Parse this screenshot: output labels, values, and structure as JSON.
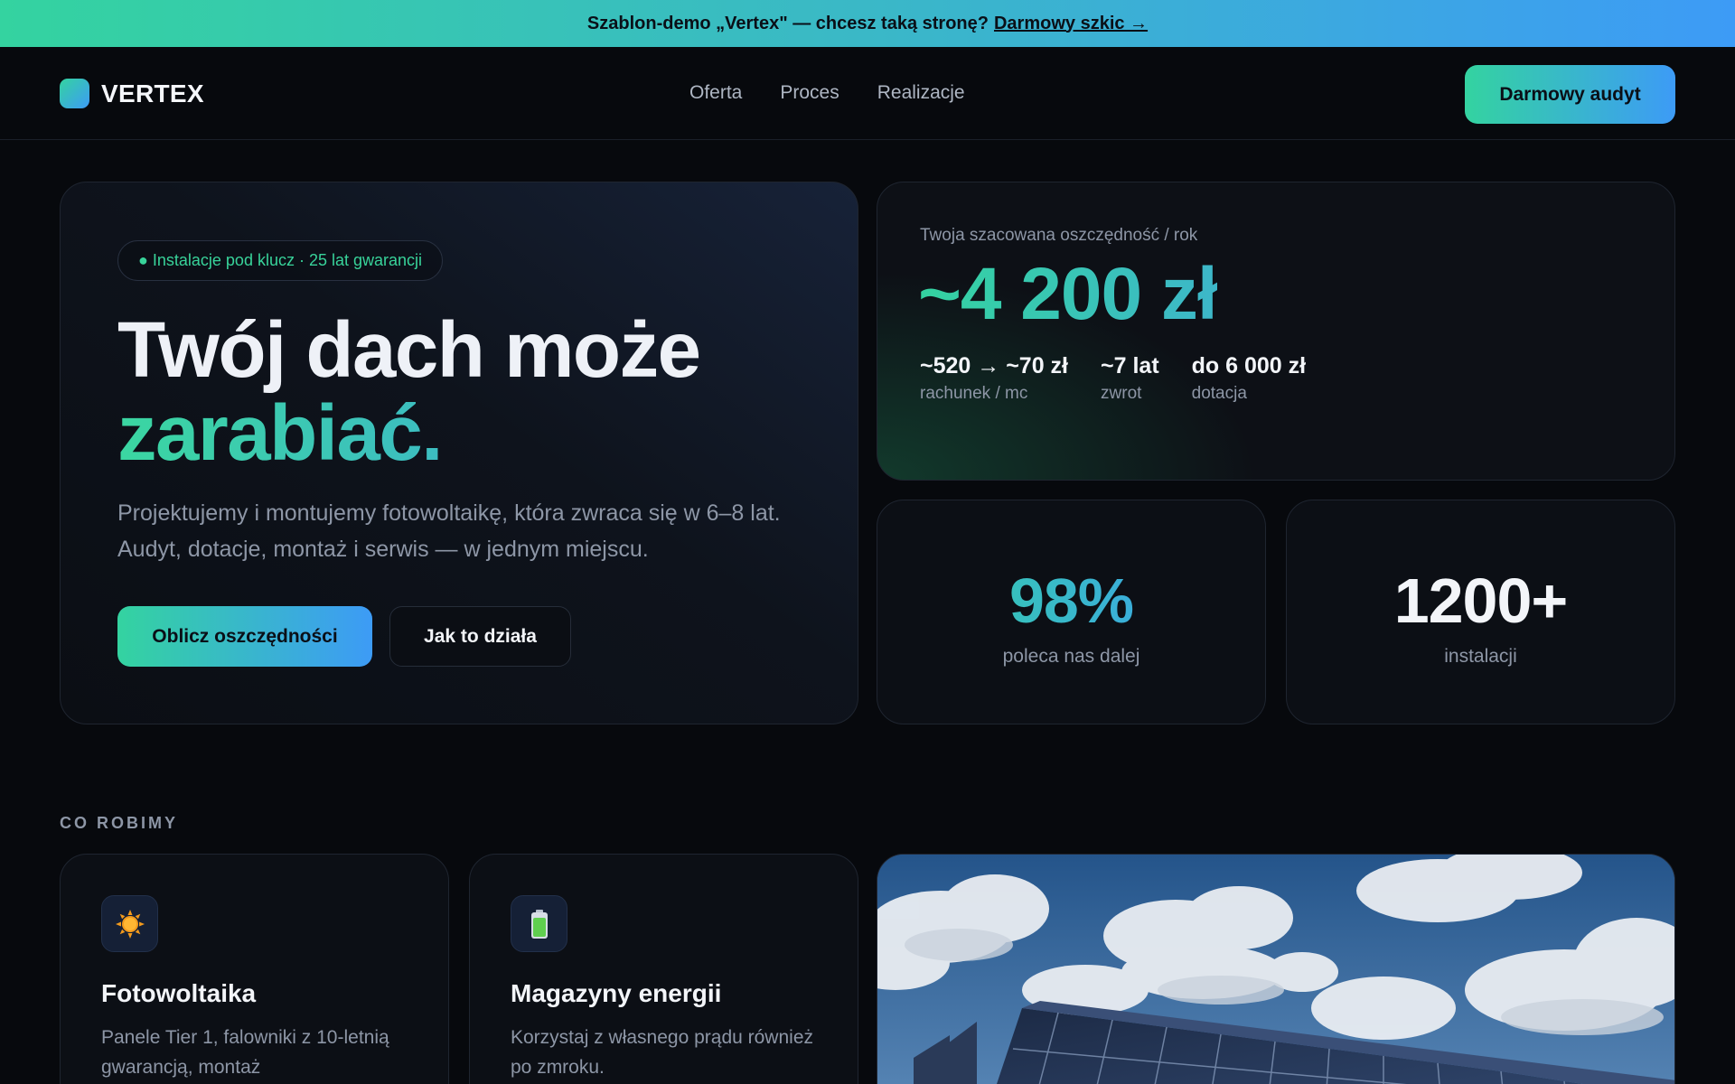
{
  "announcement": {
    "text": "Szablon-demo „Vertex\" — chcesz taką stronę?",
    "link": "Darmowy szkic →"
  },
  "nav": {
    "brand": "VERTEX",
    "links": [
      "Oferta",
      "Proces",
      "Realizacje"
    ],
    "cta": "Darmowy audyt"
  },
  "hero": {
    "pill": "● Instalacje pod klucz · 25 lat gwarancji",
    "title_line1": "Twój dach może",
    "title_line2": "zarabiać.",
    "subtitle": "Projektujemy i montujemy fotowoltaikę, która zwraca się w 6–8 lat. Audyt, dotacje, montaż i serwis — w jednym miejscu.",
    "primary_button": "Oblicz oszczędności",
    "secondary_button": "Jak to działa"
  },
  "savings": {
    "label": "Twoja szacowana oszczędność / rok",
    "value": "~4 200 zł",
    "stats": [
      {
        "value": "~520 → ~70 zł",
        "label": "rachunek / mc"
      },
      {
        "value": "~7 lat",
        "label": "zwrot"
      },
      {
        "value": "do 6 000 zł",
        "label": "dotacja"
      }
    ]
  },
  "stats": [
    {
      "value": "98%",
      "label": "poleca nas dalej"
    },
    {
      "value": "1200+",
      "label": "instalacji"
    }
  ],
  "section": {
    "label": "CO ROBIMY"
  },
  "services": [
    {
      "icon": "sun-icon",
      "title": "Fotowoltaika",
      "description": "Panele Tier 1, falowniki z 10-letnią gwarancją, montaż"
    },
    {
      "icon": "battery-icon",
      "title": "Magazyny energii",
      "description": "Korzystaj z własnego prądu również po zmroku."
    }
  ],
  "colors": {
    "background": "#07090d",
    "accent_green": "#34d3a0",
    "accent_blue": "#3d9bf6",
    "muted_text": "#8d96a6"
  }
}
